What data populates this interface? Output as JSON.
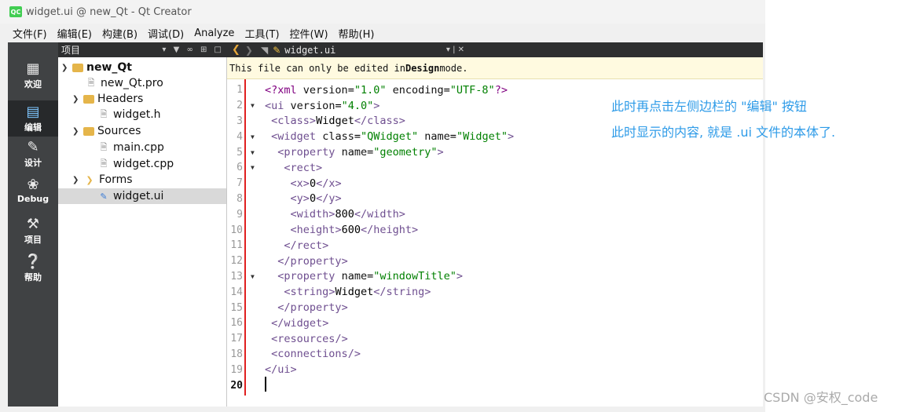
{
  "window": {
    "title": "widget.ui @ new_Qt - Qt Creator",
    "logo": "QC"
  },
  "menubar": [
    "文件(F)",
    "编辑(E)",
    "构建(B)",
    "调试(D)",
    "Analyze",
    "工具(T)",
    "控件(W)",
    "帮助(H)"
  ],
  "modebar": [
    {
      "label": "欢迎",
      "icon": "grid-icon"
    },
    {
      "label": "编辑",
      "icon": "document-icon",
      "active": true
    },
    {
      "label": "设计",
      "icon": "pencil-icon"
    },
    {
      "label": "Debug",
      "icon": "bug-icon"
    },
    {
      "label": "项目",
      "icon": "wrench-icon"
    },
    {
      "label": "帮助",
      "icon": "help-icon"
    }
  ],
  "project_panel": {
    "header": "项目",
    "tree": [
      {
        "label": "new_Qt",
        "bold": true
      },
      {
        "label": "new_Qt.pro"
      },
      {
        "label": "Headers"
      },
      {
        "label": "widget.h"
      },
      {
        "label": "Sources"
      },
      {
        "label": "main.cpp"
      },
      {
        "label": "widget.cpp"
      },
      {
        "label": "Forms"
      },
      {
        "label": "widget.ui",
        "selected": true
      }
    ]
  },
  "editor": {
    "tab_filename": "widget.ui",
    "info_prefix": "This file can only be edited in ",
    "info_bold": "Design",
    "info_suffix": " mode.",
    "lines": [
      "<?xml version=\"1.0\" encoding=\"UTF-8\"?>",
      "<ui version=\"4.0\">",
      " <class>Widget</class>",
      " <widget class=\"QWidget\" name=\"Widget\">",
      "  <property name=\"geometry\">",
      "   <rect>",
      "    <x>0</x>",
      "    <y>0</y>",
      "    <width>800</width>",
      "    <height>600</height>",
      "   </rect>",
      "  </property>",
      "  <property name=\"windowTitle\">",
      "   <string>Widget</string>",
      "  </property>",
      " </widget>",
      " <resources/>",
      " <connections/>",
      "</ui>",
      ""
    ],
    "line_numbers": [
      "1",
      "2",
      "3",
      "4",
      "5",
      "6",
      "7",
      "8",
      "9",
      "10",
      "11",
      "12",
      "13",
      "14",
      "15",
      "16",
      "17",
      "18",
      "19",
      "20"
    ]
  },
  "annotations": {
    "line1": "此时再点击左侧边栏的 \"编辑\" 按钮",
    "line2": "此时显示的内容, 就是 .ui 文件的本体了."
  },
  "watermark": "CSDN @安权_code",
  "colors": {
    "annotation": "#2e9be8",
    "sidebar": "#404244",
    "highlight": "#e02020"
  }
}
